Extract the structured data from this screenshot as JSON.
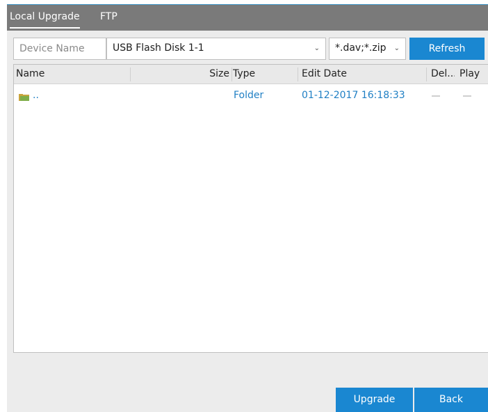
{
  "tabs": [
    {
      "label": "Local Upgrade",
      "active": true
    },
    {
      "label": "FTP",
      "active": false
    }
  ],
  "toolbar": {
    "device_label": "Device Name",
    "device_value": "USB Flash Disk 1-1",
    "filter_value": "*.dav;*.zip",
    "refresh_label": "Refresh"
  },
  "table": {
    "columns": [
      "Name",
      "Size",
      "Type",
      "Edit Date",
      "Del...",
      "Play"
    ],
    "rows": [
      {
        "name": "..",
        "size": "",
        "type": "Folder",
        "edit_date": "01-12-2017 16:18:33",
        "del": "",
        "play": ""
      }
    ]
  },
  "footer": {
    "upgrade_label": "Upgrade",
    "back_label": "Back"
  },
  "colors": {
    "accent": "#1a87d1",
    "header_bar": "#7a7a7a",
    "link_text": "#1f7fc4"
  },
  "icons": {
    "row_icon": "folder-up-icon",
    "dropdown": "chevron-down-icon"
  }
}
